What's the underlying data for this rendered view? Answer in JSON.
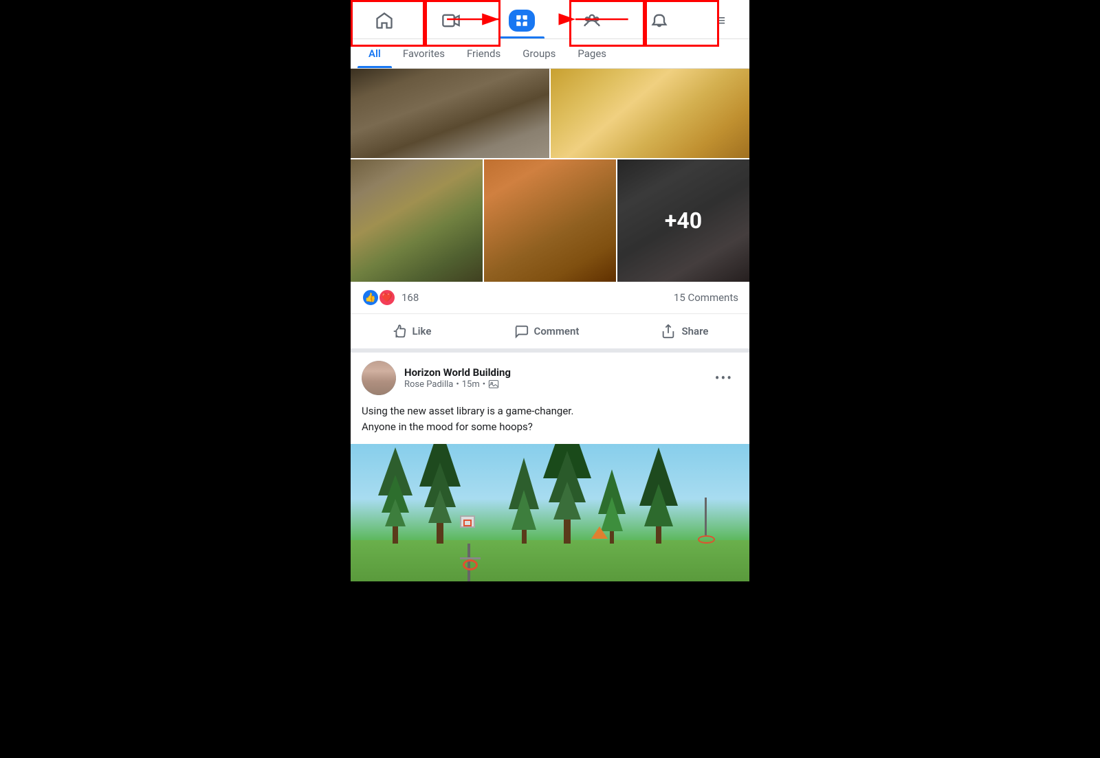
{
  "nav": {
    "icons": [
      {
        "name": "home-icon",
        "label": "Home",
        "active": false
      },
      {
        "name": "video-icon",
        "label": "Video",
        "active": false
      },
      {
        "name": "feed-icon",
        "label": "Feed",
        "active": true
      },
      {
        "name": "groups-icon",
        "label": "Groups",
        "active": false
      },
      {
        "name": "bell-icon",
        "label": "Notifications",
        "active": false
      },
      {
        "name": "menu-icon",
        "label": "Menu",
        "active": false
      }
    ]
  },
  "filters": {
    "tabs": [
      {
        "label": "All",
        "active": true
      },
      {
        "label": "Favorites",
        "active": false
      },
      {
        "label": "Friends",
        "active": false
      },
      {
        "label": "Groups",
        "active": false
      },
      {
        "label": "Pages",
        "active": false
      }
    ]
  },
  "post1": {
    "reactions": {
      "count": "168",
      "like_emoji": "👍",
      "love_emoji": "❤️"
    },
    "comments_count": "15 Comments",
    "actions": {
      "like": "Like",
      "comment": "Comment",
      "share": "Share"
    },
    "plus_overlay": "+40"
  },
  "post2": {
    "group_name": "Horizon World Building",
    "author": "Rose Padilla",
    "time": "15m",
    "body_line1": "Using the new asset library is a game-changer.",
    "body_line2": "Anyone in the mood for some hoops?",
    "horizon_label": "Horizon World"
  },
  "colors": {
    "accent": "#1877f2",
    "text_primary": "#1c1e21",
    "text_secondary": "#606770"
  }
}
